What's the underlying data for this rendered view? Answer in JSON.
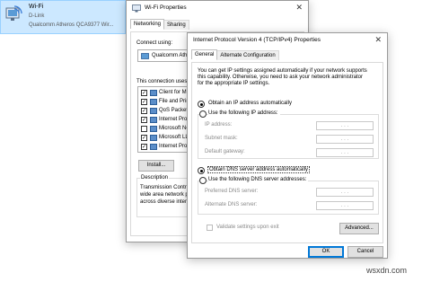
{
  "adapter": {
    "name": "Wi-Fi",
    "network": "D-Link",
    "device": "Qualcomm Atheros QCA9377 Wir..."
  },
  "wifi_props": {
    "title": "Wi-Fi Properties",
    "tabs": [
      "Networking",
      "Sharing"
    ],
    "connect_using_label": "Connect using:",
    "adapter_name": "Qualcomm Athe",
    "connection_uses_label": "This connection uses",
    "items": [
      {
        "label": "Client for Mic",
        "checked": true
      },
      {
        "label": "File and Print",
        "checked": true
      },
      {
        "label": "QoS Packet",
        "checked": true
      },
      {
        "label": "Internet Proto",
        "checked": true
      },
      {
        "label": "Microsoft Net",
        "checked": false
      },
      {
        "label": "Microsoft LLD",
        "checked": true
      },
      {
        "label": "Internet Proto",
        "checked": true
      }
    ],
    "install_button": "Install...",
    "description_label": "Description",
    "description_text": [
      "Transmission Contro",
      "wide area network p",
      "across diverse inter"
    ]
  },
  "ipv4": {
    "title": "Internet Protocol Version 4 (TCP/IPv4) Properties",
    "tabs": [
      "General",
      "Alternate Configuration"
    ],
    "intro": [
      "You can get IP settings assigned automatically if your network supports",
      "this capability. Otherwise, you need to ask your network administrator",
      "for the appropriate IP settings."
    ],
    "obtain_ip_auto": "Obtain an IP address automatically",
    "use_ip": "Use the following IP address:",
    "ip_address_label": "IP address:",
    "subnet_label": "Subnet mask:",
    "gateway_label": "Default gateway:",
    "obtain_dns_auto": "Obtain DNS server address automatically",
    "use_dns": "Use the following DNS server addresses:",
    "preferred_dns_label": "Preferred DNS server:",
    "alternate_dns_label": "Alternate DNS server:",
    "validate_label": "Validate settings upon exit",
    "advanced_button": "Advanced...",
    "ok_button": "OK",
    "cancel_button": "Cancel",
    "ip_dots": ". . ."
  },
  "watermark": "wsxdn.com"
}
